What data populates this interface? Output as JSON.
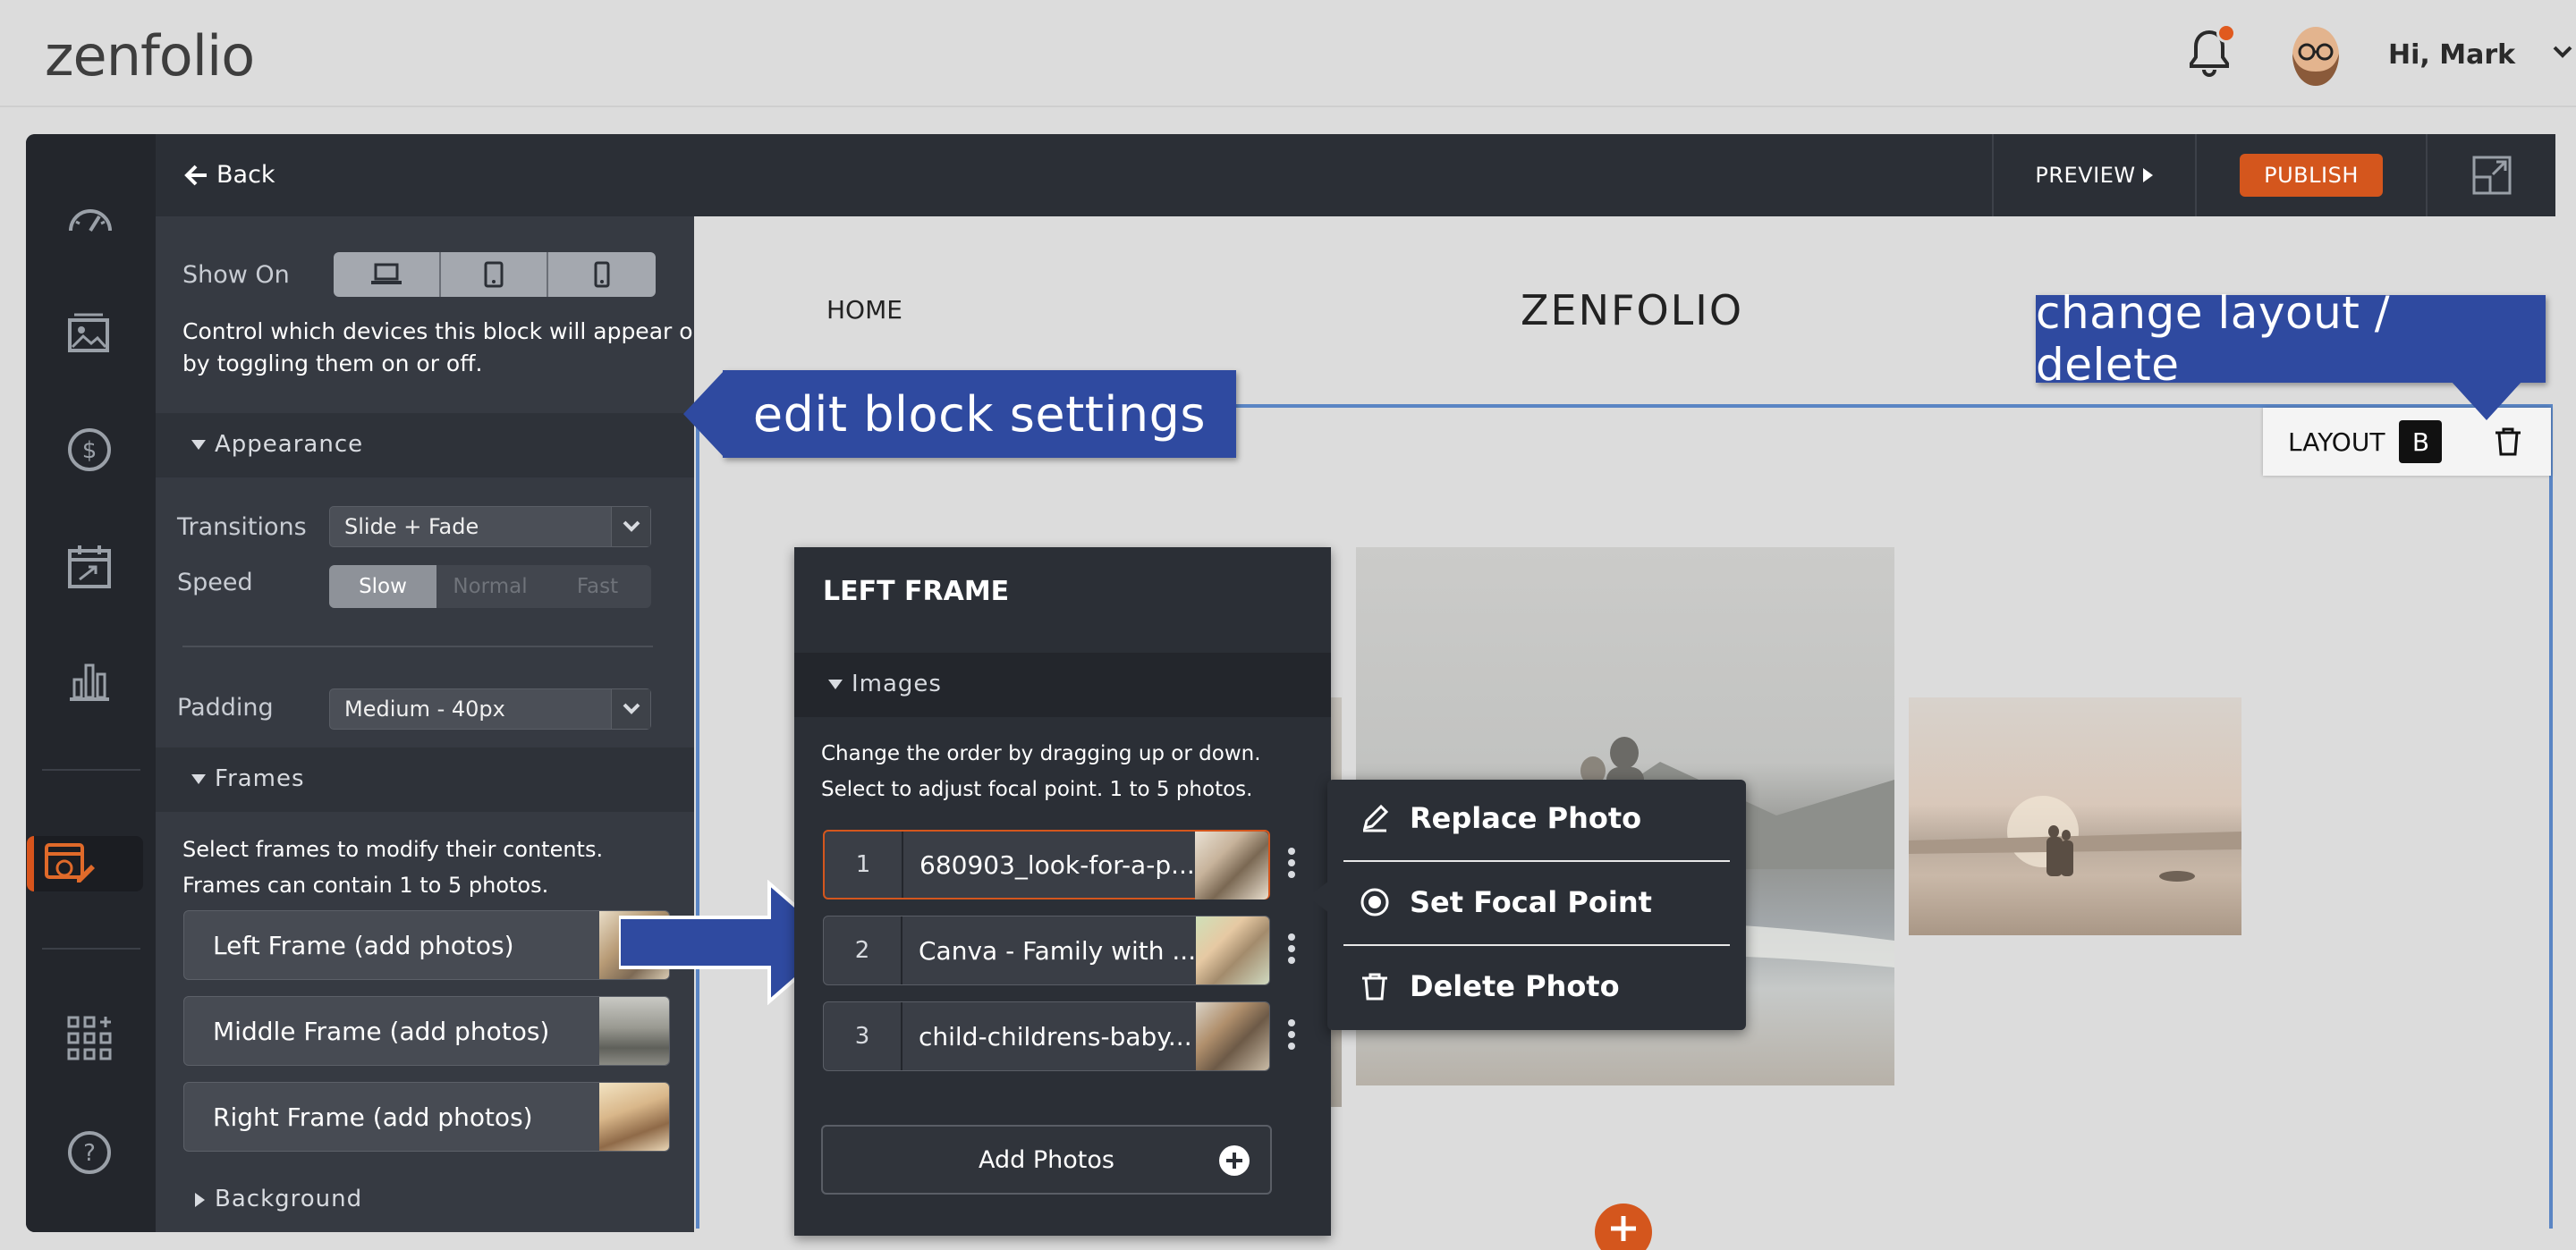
{
  "app": {
    "logo": "zenfolio",
    "greeting": "Hi, Mark"
  },
  "sidebar": {
    "back_label": "Back",
    "show_on_label": "Show On",
    "show_on_help": [
      "Control which devices this block will appear on",
      "by toggling them on or off."
    ],
    "appearance": {
      "section_label": "Appearance",
      "transitions_label": "Transitions",
      "transitions_value": "Slide + Fade",
      "speed_label": "Speed",
      "speed_options": [
        "Slow",
        "Normal",
        "Fast"
      ],
      "speed_selected": "Slow",
      "padding_label": "Padding",
      "padding_value": "Medium - 40px"
    },
    "frames": {
      "section_label": "Frames",
      "help": [
        "Select frames to modify their contents.",
        "Frames can contain 1 to 5 photos."
      ],
      "items": [
        {
          "label": "Left Frame (add photos)"
        },
        {
          "label": "Middle Frame (add photos)"
        },
        {
          "label": "Right Frame (add photos)"
        }
      ]
    },
    "background_label": "Background"
  },
  "toolbar": {
    "preview_label": "PREVIEW",
    "publish_label": "PUBLISH"
  },
  "site": {
    "nav_home": "HOME",
    "title": "ZENFOLIO"
  },
  "block_toolbar": {
    "layout_label": "LAYOUT",
    "layout_value": "B"
  },
  "callouts": {
    "edit": "edit block settings",
    "layout": "change layout / delete"
  },
  "left_frame": {
    "title": "LEFT FRAME",
    "images_label": "Images",
    "help": [
      "Change the order by dragging up or down.",
      "Select to adjust focal point. 1 to 5 photos."
    ],
    "images": [
      {
        "num": "1",
        "name": "680903_look-for-a-p..."
      },
      {
        "num": "2",
        "name": "Canva - Family with ..."
      },
      {
        "num": "3",
        "name": "child-childrens-baby..."
      }
    ],
    "add_label": "Add Photos"
  },
  "context_menu": {
    "items": [
      "Replace Photo",
      "Set Focal Point",
      "Delete Photo"
    ]
  },
  "colors": {
    "accent": "#d4561d",
    "callout": "#2f4aa0",
    "selection": "#5a85c4"
  }
}
